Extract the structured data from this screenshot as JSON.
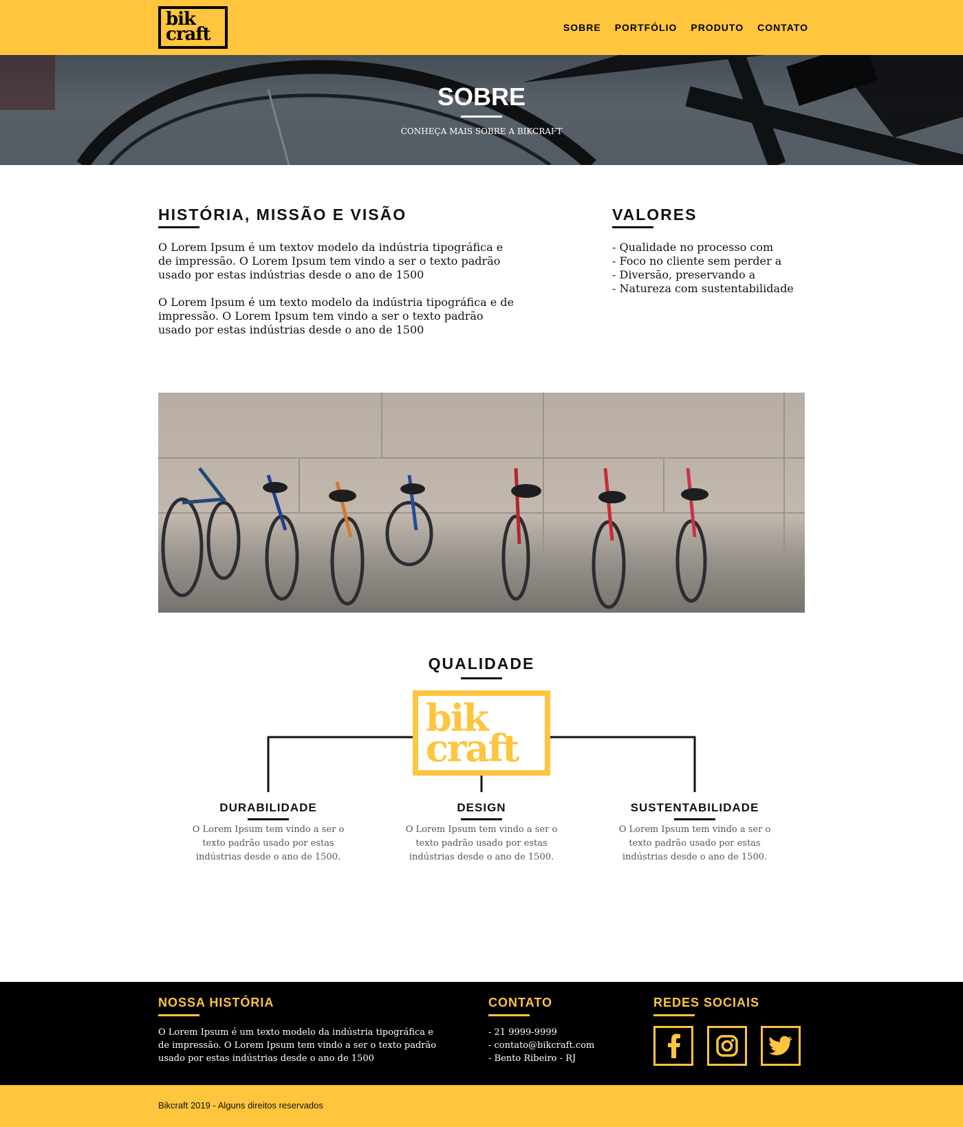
{
  "header": {
    "logo": {
      "line1": "bik",
      "line2": "craft"
    },
    "nav": [
      "SOBRE",
      "PORTFÓLIO",
      "PRODUTO",
      "CONTATO"
    ]
  },
  "hero": {
    "title": "SOBRE",
    "subtitle": "CONHEÇA MAIS SOBRE A BIKCRAFT"
  },
  "historia": {
    "title": "HISTÓRIA, MISSÃO E VISÃO",
    "paragraphs": [
      "O Lorem Ipsum é um textov modelo da indústria tipográfica e de impressão. O Lorem Ipsum tem vindo a ser o texto padrão usado por estas indústrias desde o ano de 1500",
      "O Lorem Ipsum é um texto modelo da indústria tipográfica e de impressão. O Lorem Ipsum tem vindo a ser o texto padrão usado por estas indústrias desde o ano de 1500"
    ]
  },
  "valores": {
    "title": "VALORES",
    "items": [
      "- Qualidade no processo com",
      "- Foco no cliente sem perder a",
      "- Diversão, preservando a",
      "- Natureza com sustentabilidade"
    ]
  },
  "qualidade": {
    "title": "QUALIDADE",
    "logo": {
      "line1": "bik",
      "line2": "craft"
    },
    "items": [
      {
        "title": "DURABILIDADE",
        "text": "O Lorem Ipsum tem vindo a ser o texto padrão usado por estas indústrias desde o ano de 1500."
      },
      {
        "title": "DESIGN",
        "text": "O Lorem Ipsum tem vindo a ser o texto padrão usado por estas indústrias desde o ano de 1500."
      },
      {
        "title": "SUSTENTABILIDADE",
        "text": "O Lorem Ipsum tem vindo a ser o texto padrão usado por estas indústrias desde o ano de 1500."
      }
    ]
  },
  "footer": {
    "historia": {
      "title": "NOSSA HISTÓRIA",
      "text": "O Lorem Ipsum é um texto modelo da indústria tipográfica e de impressão. O Lorem Ipsum tem vindo a ser o texto padrão usado por estas indústrias desde o ano de 1500"
    },
    "contato": {
      "title": "CONTATO",
      "items": [
        "- 21 9999-9999",
        "- contato@bikcraft.com",
        "- Bento Ribeiro - RJ"
      ]
    },
    "redes": {
      "title": "REDES SOCIAIS",
      "icons": [
        "facebook-icon",
        "instagram-icon",
        "twitter-icon"
      ]
    },
    "copyright": "Bikcraft 2019 - Alguns direitos reservados"
  },
  "colors": {
    "accent": "#fec53d",
    "dark": "#000000",
    "text": "#111111"
  }
}
